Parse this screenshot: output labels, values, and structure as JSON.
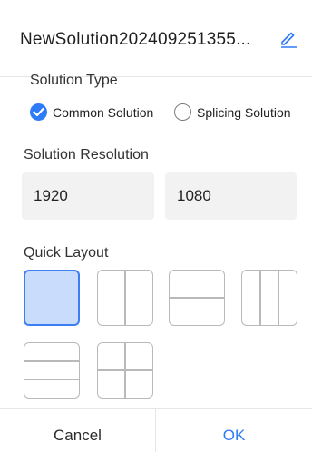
{
  "header": {
    "title": "NewSolution202409251355...",
    "edit_icon": "pencil-edit-icon"
  },
  "solution_type": {
    "label": "Solution Type",
    "options": [
      {
        "label": "Common Solution",
        "checked": true
      },
      {
        "label": "Splicing Solution",
        "checked": false
      }
    ]
  },
  "solution_resolution": {
    "label": "Solution Resolution",
    "width": "1920",
    "height": "1080"
  },
  "quick_layout": {
    "label": "Quick Layout",
    "options": [
      {
        "name": "single",
        "selected": true
      },
      {
        "name": "two-columns",
        "selected": false
      },
      {
        "name": "two-rows",
        "selected": false
      },
      {
        "name": "three-columns",
        "selected": false
      },
      {
        "name": "three-rows",
        "selected": false
      },
      {
        "name": "four-grid",
        "selected": false
      }
    ]
  },
  "footer": {
    "cancel_label": "Cancel",
    "ok_label": "OK"
  },
  "colors": {
    "accent": "#2e7bf6",
    "selected_fill": "#c9dcfb",
    "input_bg": "#f2f2f2"
  }
}
